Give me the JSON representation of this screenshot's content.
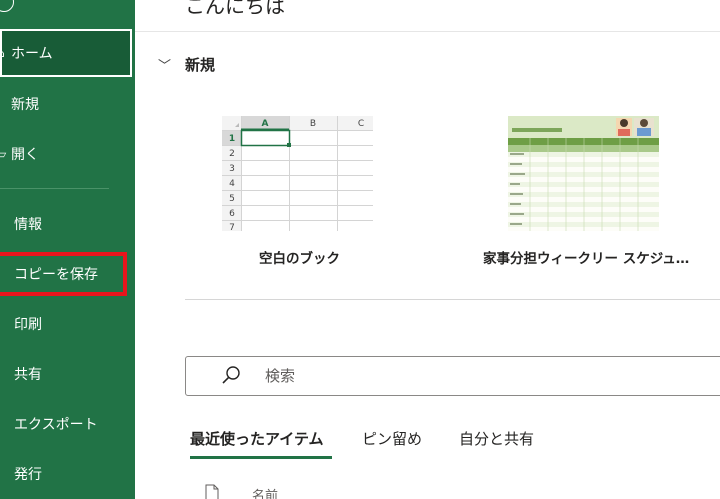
{
  "greeting": "こんにちは",
  "sidebar": {
    "home": "ホーム",
    "new": "新規",
    "open": "開く",
    "info": "情報",
    "save_copy": "コピーを保存",
    "print": "印刷",
    "share": "共有",
    "export": "エクスポート",
    "publish": "発行"
  },
  "new_section": {
    "title": "新規",
    "templates": [
      {
        "label": "空白のブック",
        "columns": [
          "A",
          "B",
          "C"
        ],
        "rows": [
          "1",
          "2",
          "3",
          "4",
          "5",
          "6",
          "7"
        ]
      },
      {
        "label": "家事分担ウィークリー スケジュ…"
      }
    ]
  },
  "search": {
    "placeholder": "検索"
  },
  "tabs": {
    "recent": "最近使ったアイテム",
    "pinned": "ピン留め",
    "shared": "自分と共有"
  },
  "file_list": {
    "name_header": "名前"
  },
  "colors": {
    "sidebar": "#217346",
    "sidebar_selected": "#185c37",
    "highlight": "#e8151c"
  }
}
